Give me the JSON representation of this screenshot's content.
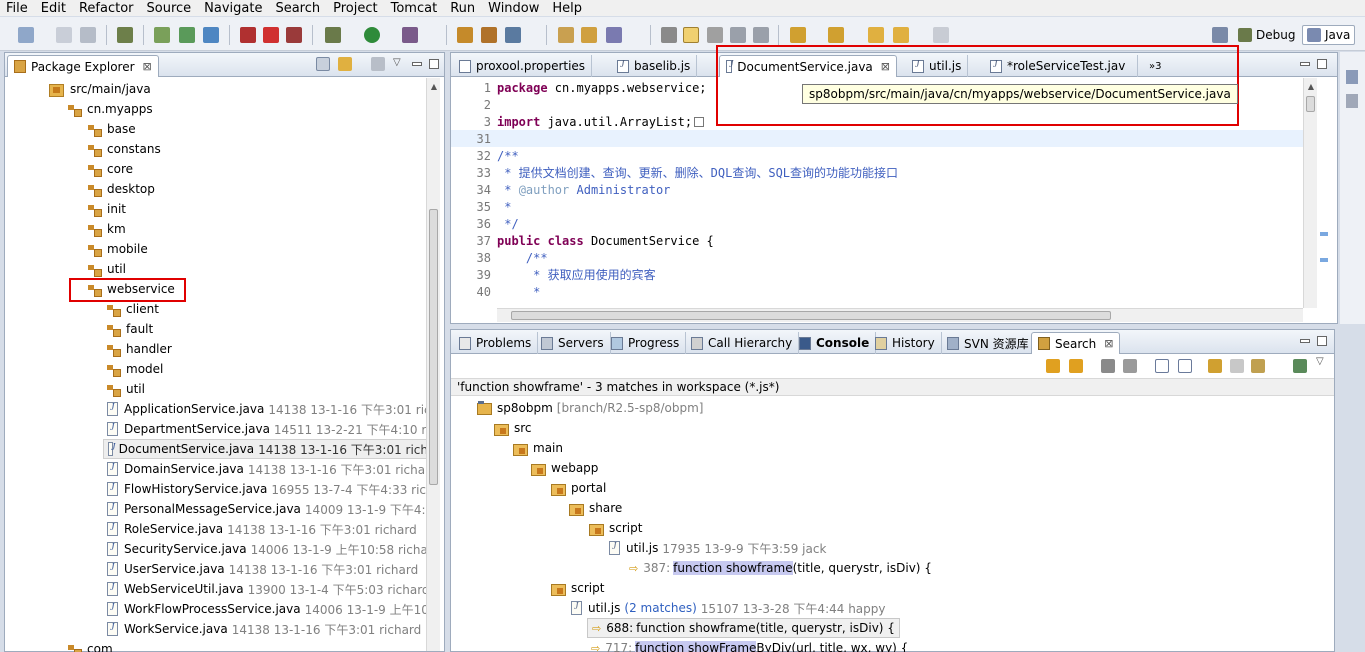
{
  "menu": [
    "File",
    "Edit",
    "Refactor",
    "Source",
    "Navigate",
    "Search",
    "Project",
    "Tomcat",
    "Run",
    "Window",
    "Help"
  ],
  "perspectives": {
    "debug": "Debug",
    "java": "Java"
  },
  "package_explorer": {
    "title": "Package Explorer",
    "close": "⊠",
    "rows": [
      {
        "label": "src/main/java",
        "meta": "",
        "kind": "srcfolder"
      },
      {
        "label": "cn.myapps",
        "meta": "",
        "kind": "pkg"
      },
      {
        "label": "base",
        "meta": "",
        "kind": "pkg"
      },
      {
        "label": "constans",
        "meta": "",
        "kind": "pkg"
      },
      {
        "label": "core",
        "meta": "",
        "kind": "pkg"
      },
      {
        "label": "desktop",
        "meta": "",
        "kind": "pkg"
      },
      {
        "label": "init",
        "meta": "",
        "kind": "pkg"
      },
      {
        "label": "km",
        "meta": "",
        "kind": "pkg"
      },
      {
        "label": "mobile",
        "meta": "",
        "kind": "pkg"
      },
      {
        "label": "util",
        "meta": "",
        "kind": "pkg"
      },
      {
        "label": "webservice",
        "meta": "",
        "kind": "pkg"
      },
      {
        "label": "client",
        "meta": "",
        "kind": "pkg"
      },
      {
        "label": "fault",
        "meta": "",
        "kind": "pkg"
      },
      {
        "label": "handler",
        "meta": "",
        "kind": "pkg"
      },
      {
        "label": "model",
        "meta": "",
        "kind": "pkg"
      },
      {
        "label": "util",
        "meta": "",
        "kind": "pkg"
      },
      {
        "label": "ApplicationService.java",
        "meta": "14138  13-1-16 下午3:01  rich",
        "kind": "java"
      },
      {
        "label": "DepartmentService.java",
        "meta": "14511  13-2-21 下午4:10  ric",
        "kind": "java"
      },
      {
        "label": "DocumentService.java",
        "meta": "14138  13-1-16 下午3:01  rich",
        "kind": "java"
      },
      {
        "label": "DomainService.java",
        "meta": "14138  13-1-16 下午3:01  richar",
        "kind": "java"
      },
      {
        "label": "FlowHistoryService.java",
        "meta": "16955  13-7-4 下午4:33  rich",
        "kind": "java"
      },
      {
        "label": "PersonalMessageService.java",
        "meta": "14009  13-1-9 下午4:3",
        "kind": "java"
      },
      {
        "label": "RoleService.java",
        "meta": "14138  13-1-16 下午3:01  richard",
        "kind": "java"
      },
      {
        "label": "SecurityService.java",
        "meta": "14006  13-1-9 上午10:58  richar",
        "kind": "java"
      },
      {
        "label": "UserService.java",
        "meta": "14138  13-1-16 下午3:01  richard",
        "kind": "java"
      },
      {
        "label": "WebServiceUtil.java",
        "meta": "13900  13-1-4 下午5:03  richard",
        "kind": "java"
      },
      {
        "label": "WorkFlowProcessService.java",
        "meta": "14006  13-1-9 上午10:",
        "kind": "java"
      },
      {
        "label": "WorkService.java",
        "meta": "14138  13-1-16 下午3:01  richard",
        "kind": "java"
      },
      {
        "label": "com",
        "meta": "",
        "kind": "pkg"
      }
    ]
  },
  "editor": {
    "tabs": [
      "proxool.properties",
      "baselib.js",
      "DocumentService.java",
      "util.js",
      "*roleServiceTest.jav"
    ],
    "overflow": "»3",
    "tooltip": "sp8obpm/src/main/java/cn/myapps/webservice/DocumentService.java",
    "lines": [
      {
        "n": "1",
        "text": "package cn.myapps.webservice;"
      },
      {
        "n": "2",
        "text": ""
      },
      {
        "n": "3",
        "text": "import java.util.ArrayList;"
      },
      {
        "n": "31",
        "text": ""
      },
      {
        "n": "32",
        "text": "/**"
      },
      {
        "n": "33",
        "text": " * 提供文档创建、查询、更新、删除、DQL查询、SQL查询的功能功能接口"
      },
      {
        "n": "34",
        "text": " * @author Administrator"
      },
      {
        "n": "35",
        "text": " *"
      },
      {
        "n": "36",
        "text": " */"
      },
      {
        "n": "37",
        "text": "public class DocumentService {"
      },
      {
        "n": "38",
        "text": "    /**"
      },
      {
        "n": "39",
        "text": "     * 获取应用使用的宾客"
      },
      {
        "n": "40",
        "text": "     *"
      }
    ]
  },
  "bottom": {
    "tabs": [
      "Problems",
      "Servers",
      "Progress",
      "Call Hierarchy",
      "Console",
      "History",
      "SVN 资源库",
      "Search"
    ],
    "summary": "'function showframe' - 3 matches in workspace (*.js*)",
    "project": "sp8obpm",
    "branch": "[branch/R2.5-sp8/obpm]",
    "folders": [
      "src",
      "main",
      "webapp",
      "portal",
      "share",
      "script"
    ],
    "file1": {
      "name": "util.js",
      "meta": "17935  13-9-9 下午3:59  jack"
    },
    "match1": {
      "line": "387:",
      "hit": "function showframe",
      "rest": "(title, querystr, isDiv) {"
    },
    "folder2": "script",
    "file2": {
      "name": "util.js",
      "count": "(2 matches)",
      "meta": "15107  13-3-28 下午4:44  happy"
    },
    "match2": {
      "line": "688:",
      "hit": "function showframe",
      "rest": "(title, querystr, isDiv) {"
    },
    "match3": {
      "line": "717:",
      "hit": "function showFrame",
      "rest": "ByDiv(url, title, wx, wy) {"
    }
  }
}
